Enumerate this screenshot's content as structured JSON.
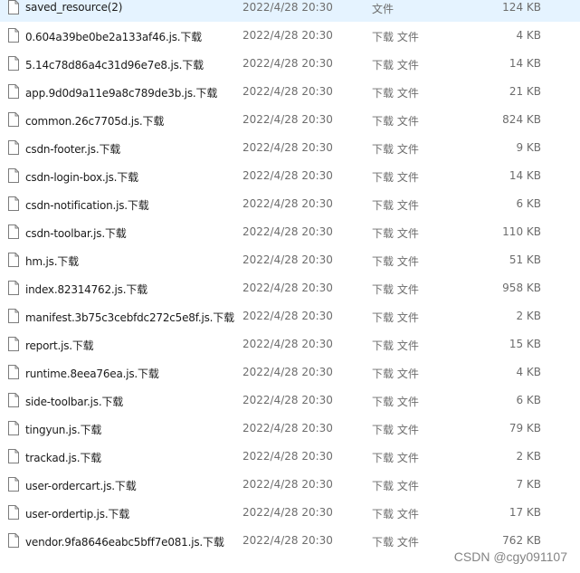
{
  "files": [
    {
      "name": "saved_resource(2)",
      "date": "2022/4/28 20:30",
      "type": "文件",
      "size": "124 KB"
    },
    {
      "name": "0.604a39be0be2a133af46.js.下载",
      "date": "2022/4/28 20:30",
      "type": "下载 文件",
      "size": "4 KB"
    },
    {
      "name": "5.14c78d86a4c31d96e7e8.js.下载",
      "date": "2022/4/28 20:30",
      "type": "下载 文件",
      "size": "14 KB"
    },
    {
      "name": "app.9d0d9a11e9a8c789de3b.js.下载",
      "date": "2022/4/28 20:30",
      "type": "下载 文件",
      "size": "21 KB"
    },
    {
      "name": "common.26c7705d.js.下载",
      "date": "2022/4/28 20:30",
      "type": "下载 文件",
      "size": "824 KB"
    },
    {
      "name": "csdn-footer.js.下载",
      "date": "2022/4/28 20:30",
      "type": "下载 文件",
      "size": "9 KB"
    },
    {
      "name": "csdn-login-box.js.下载",
      "date": "2022/4/28 20:30",
      "type": "下载 文件",
      "size": "14 KB"
    },
    {
      "name": "csdn-notification.js.下载",
      "date": "2022/4/28 20:30",
      "type": "下载 文件",
      "size": "6 KB"
    },
    {
      "name": "csdn-toolbar.js.下载",
      "date": "2022/4/28 20:30",
      "type": "下载 文件",
      "size": "110 KB"
    },
    {
      "name": "hm.js.下载",
      "date": "2022/4/28 20:30",
      "type": "下载 文件",
      "size": "51 KB"
    },
    {
      "name": "index.82314762.js.下载",
      "date": "2022/4/28 20:30",
      "type": "下载 文件",
      "size": "958 KB"
    },
    {
      "name": "manifest.3b75c3cebfdc272c5e8f.js.下载",
      "date": "2022/4/28 20:30",
      "type": "下载 文件",
      "size": "2 KB"
    },
    {
      "name": "report.js.下载",
      "date": "2022/4/28 20:30",
      "type": "下载 文件",
      "size": "15 KB"
    },
    {
      "name": "runtime.8eea76ea.js.下载",
      "date": "2022/4/28 20:30",
      "type": "下载 文件",
      "size": "4 KB"
    },
    {
      "name": "side-toolbar.js.下载",
      "date": "2022/4/28 20:30",
      "type": "下载 文件",
      "size": "6 KB"
    },
    {
      "name": "tingyun.js.下载",
      "date": "2022/4/28 20:30",
      "type": "下载 文件",
      "size": "79 KB"
    },
    {
      "name": "trackad.js.下载",
      "date": "2022/4/28 20:30",
      "type": "下载 文件",
      "size": "2 KB"
    },
    {
      "name": "user-ordercart.js.下载",
      "date": "2022/4/28 20:30",
      "type": "下载 文件",
      "size": "7 KB"
    },
    {
      "name": "user-ordertip.js.下载",
      "date": "2022/4/28 20:30",
      "type": "下载 文件",
      "size": "17 KB"
    },
    {
      "name": "vendor.9fa8646eabc5bff7e081.js.下载",
      "date": "2022/4/28 20:30",
      "type": "下载 文件",
      "size": "762 KB"
    }
  ],
  "watermark": "CSDN @cgy091107",
  "icons": {
    "file": "file-icon"
  },
  "colors": {
    "name_text": "#1b1b1b",
    "meta_text": "#6d6d6d",
    "icon_stroke": "#7c7c7c",
    "hover_bg": "#e5f3ff"
  }
}
